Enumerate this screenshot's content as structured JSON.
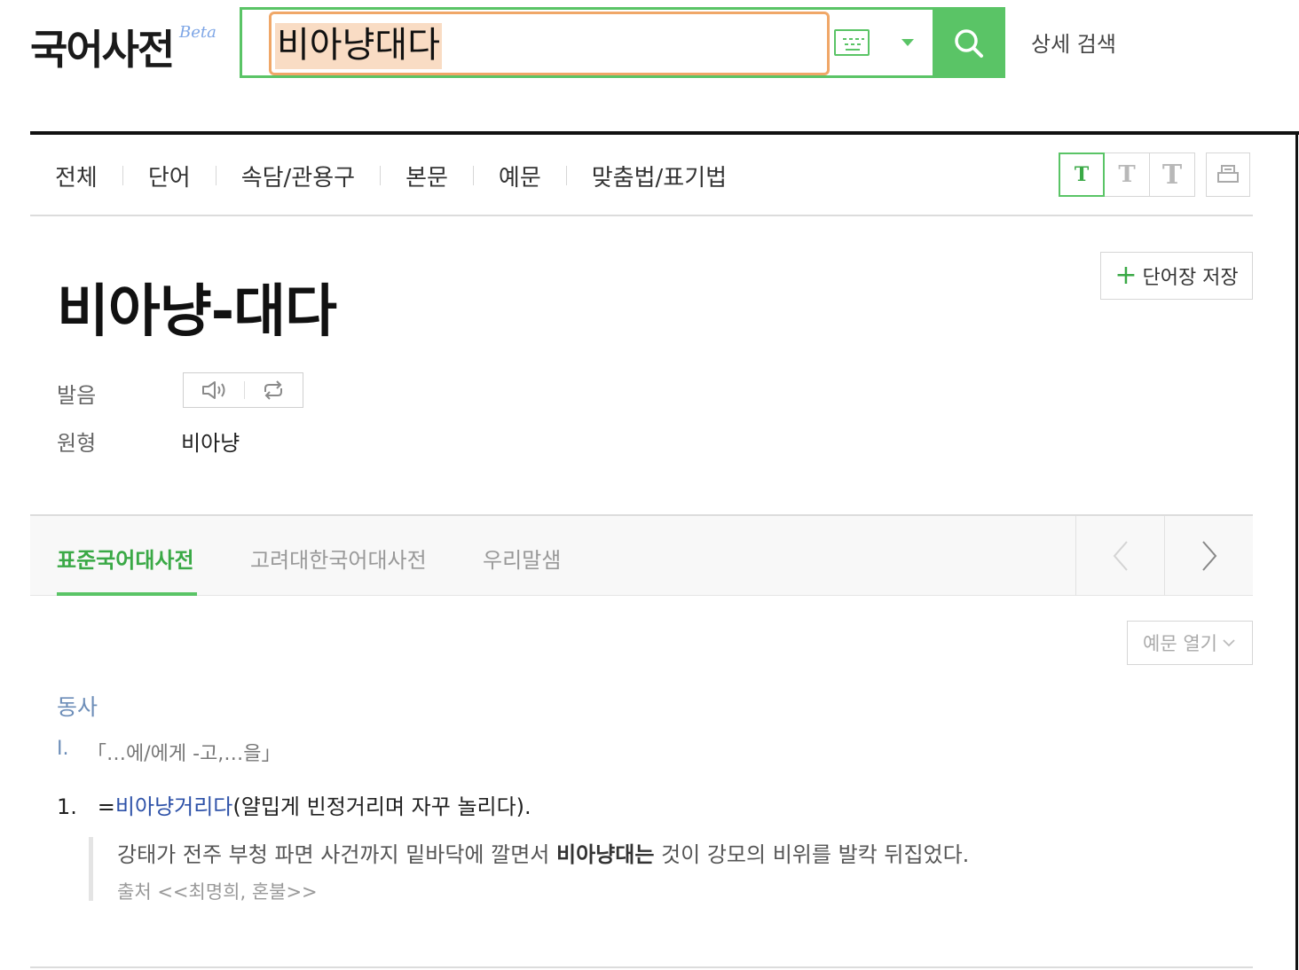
{
  "header": {
    "logo": "국어사전",
    "beta": "Beta",
    "search_value": "비아냥대다",
    "detail_search": "상세 검색"
  },
  "categories": [
    "전체",
    "단어",
    "속담/관용구",
    "본문",
    "예문",
    "맞춤법/표기법"
  ],
  "font_sizes": [
    "T",
    "T",
    "T"
  ],
  "entry": {
    "headword": "비아냥-대다",
    "save_label": "단어장 저장",
    "save_plus": "+",
    "pronunciation_label": "발음",
    "base_form_label": "원형",
    "base_form": "비아냥"
  },
  "dictionary_tabs": [
    "표준국어대사전",
    "고려대한국어대사전",
    "우리말샘"
  ],
  "body": {
    "example_toggle": "예문 열기",
    "part_of_speech": "동사",
    "sense_number": "Ⅰ.",
    "pattern": "「…에/에게 -고,…을」",
    "def_number": "1.",
    "def_prefix": "=",
    "def_link": "비아냥거리다",
    "def_text": "(얄밉게 빈정거리며 자꾸 놀리다).",
    "example_before": "강태가 전주 부청 파면 사건까지 밑바닥에 깔면서 ",
    "example_bold": "비아냥대는",
    "example_after": " 것이 강모의 비위를 발칵 뒤집었다.",
    "source": "출처 <<최명희, 혼불>>"
  },
  "colors": {
    "accent_green": "#5ac466",
    "highlight_orange": "#f0a768",
    "pos_blue": "#6c8db8",
    "link_blue": "#2d51a8"
  },
  "icons": [
    "keyboard-icon",
    "chevron-down-icon",
    "search-icon",
    "print-icon",
    "speaker-icon",
    "repeat-icon",
    "chevron-left-icon",
    "chevron-right-icon",
    "plus-icon"
  ]
}
